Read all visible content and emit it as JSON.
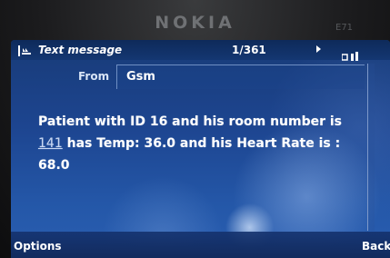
{
  "device": {
    "brand": "NOKIA",
    "model": "E71"
  },
  "status_bar": {
    "title": "Text message",
    "counter": "1/361"
  },
  "header": {
    "from_label": "From",
    "from_value": "Gsm"
  },
  "message": {
    "part1": "Patient with ID 16 and his room number is ",
    "room": "141",
    "part2": " has Temp: 36.0 and his Heart Rate is : 68.0"
  },
  "softkeys": {
    "left": "Options",
    "right": "Back"
  },
  "icons": {
    "message_type": "message-icon",
    "navigation": "next-arrow-icon",
    "signal": "signal-icon"
  }
}
